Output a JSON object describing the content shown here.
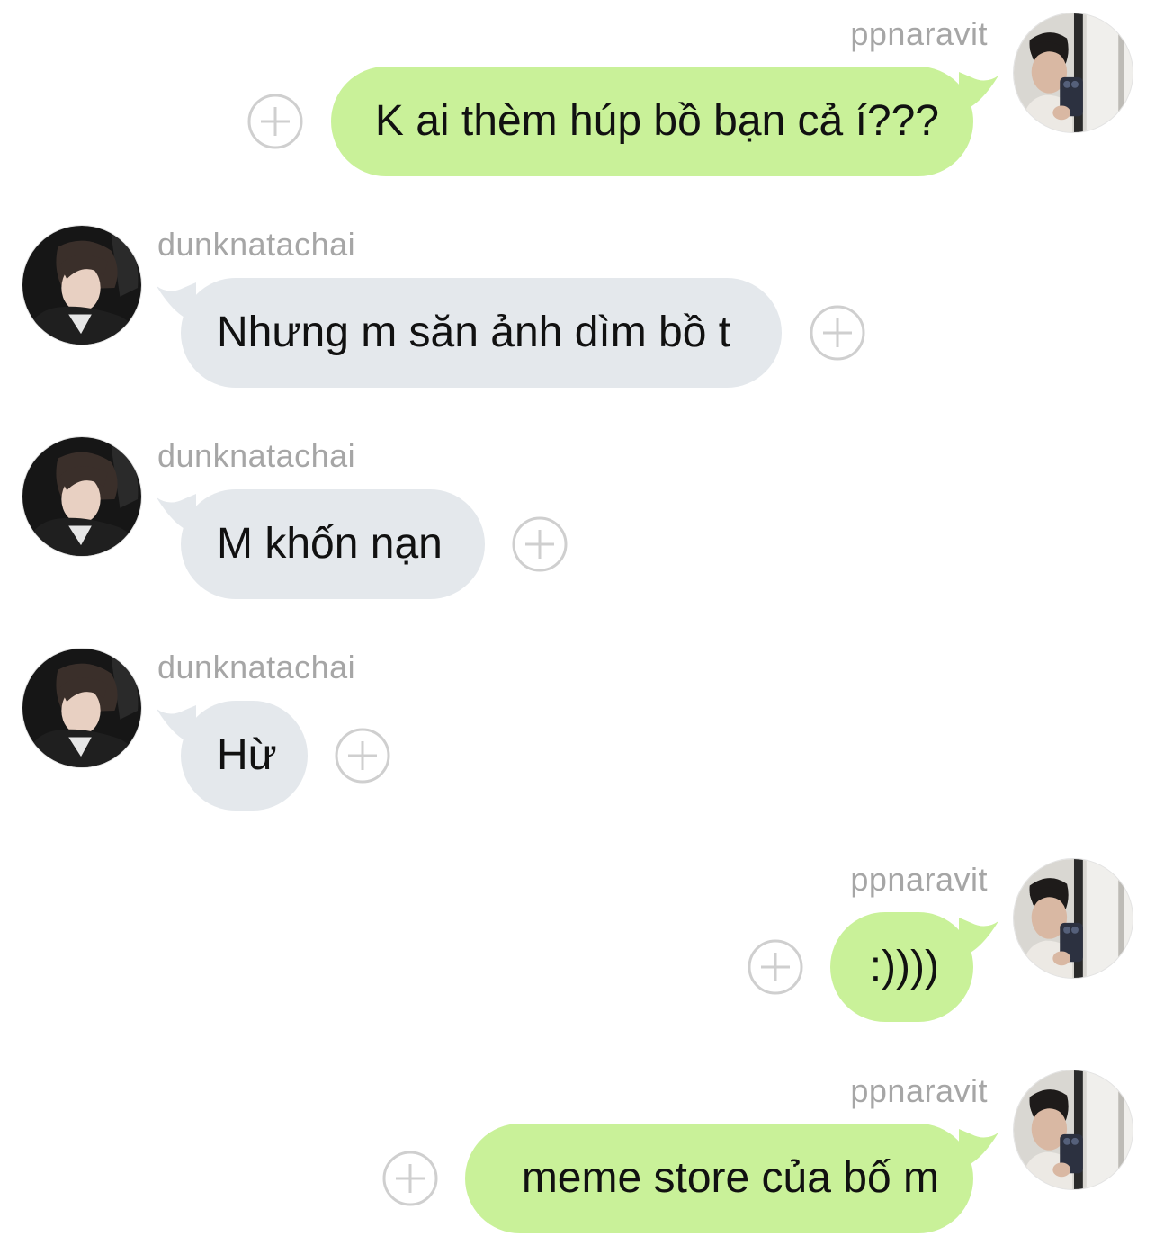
{
  "colors": {
    "outgoing_bubble": "#c9f199",
    "incoming_bubble": "#e4e8ec",
    "sender_name": "#a6a6a6",
    "plus_button": "#cfcfcf"
  },
  "icons": {
    "add_reaction": "plus-circle-icon"
  },
  "messages": [
    {
      "sender": "ppnaravit",
      "direction": "outgoing",
      "text": "K ai thèm húp bồ bạn cả í???"
    },
    {
      "sender": "dunknatachai",
      "direction": "incoming",
      "text": "Nhưng m săn ảnh dìm bồ t"
    },
    {
      "sender": "dunknatachai",
      "direction": "incoming",
      "text": "M khốn nạn"
    },
    {
      "sender": "dunknatachai",
      "direction": "incoming",
      "text": "Hừ"
    },
    {
      "sender": "ppnaravit",
      "direction": "outgoing",
      "text": ":))))"
    },
    {
      "sender": "ppnaravit",
      "direction": "outgoing",
      "text": "meme store của bố m"
    }
  ]
}
